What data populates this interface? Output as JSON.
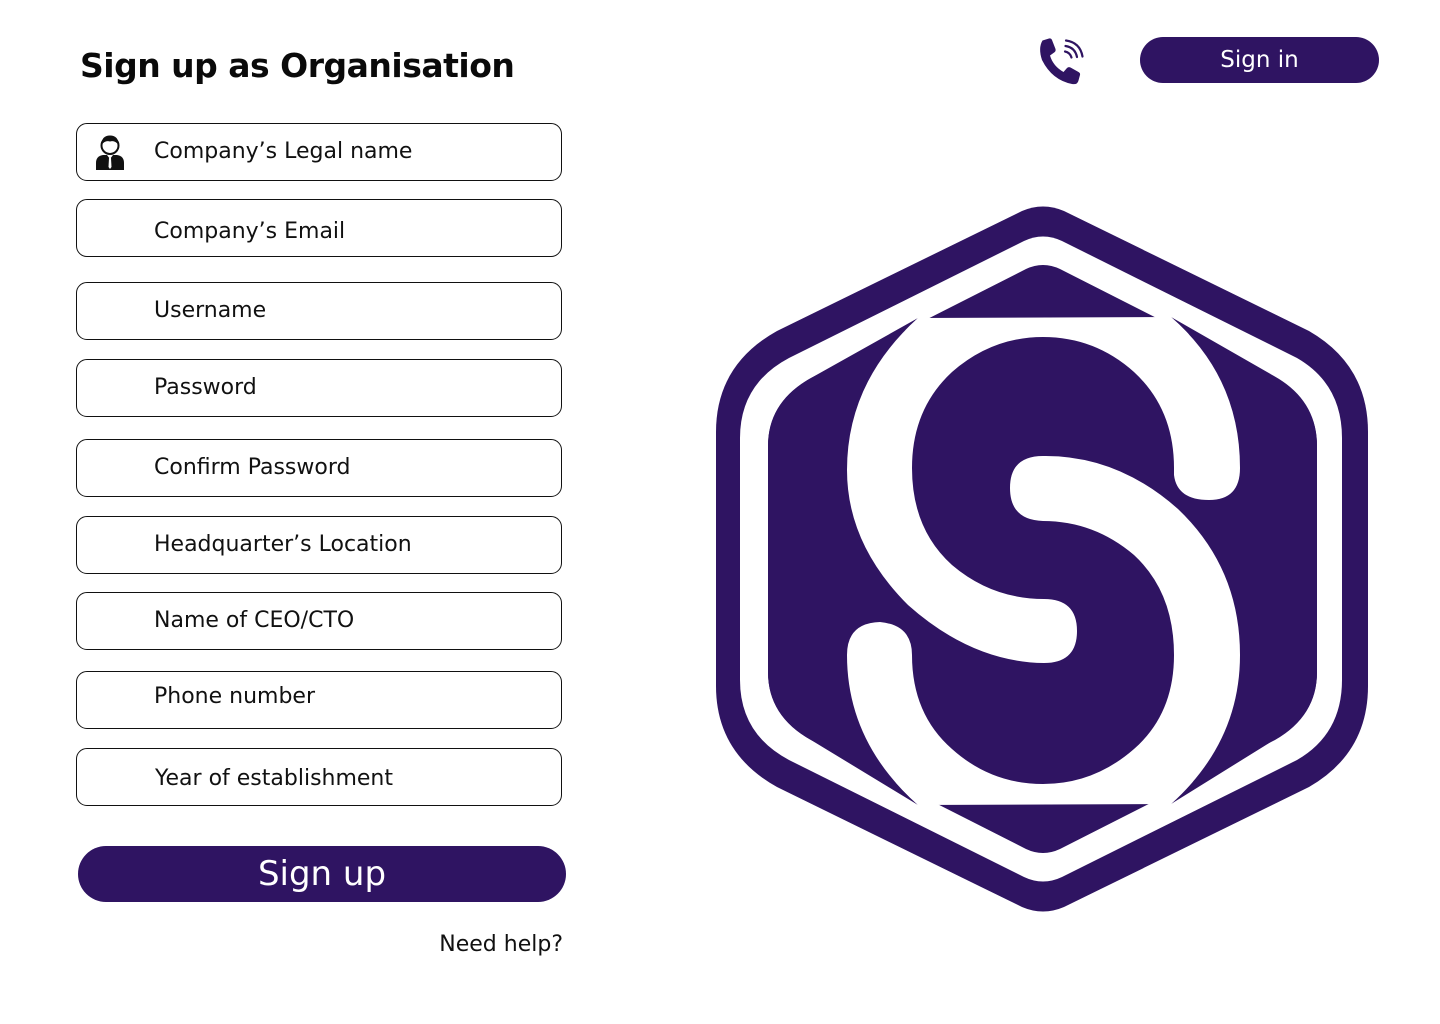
{
  "header": {
    "title": "Sign up as Organisation",
    "signin_label": "Sign in",
    "phone_icon": "phone-icon"
  },
  "form": {
    "fields": [
      {
        "name": "company-legal-name",
        "placeholder": "Company’s Legal name",
        "value": "",
        "icon": "user-icon"
      },
      {
        "name": "company-email",
        "placeholder": "Company’s Email",
        "value": ""
      },
      {
        "name": "username",
        "placeholder": "Username",
        "value": ""
      },
      {
        "name": "password",
        "placeholder": "Password",
        "value": ""
      },
      {
        "name": "confirm-password",
        "placeholder": "Confirm Password",
        "value": ""
      },
      {
        "name": "headquarter-location",
        "placeholder": "Headquarter’s Location",
        "value": ""
      },
      {
        "name": "ceo-cto-name",
        "placeholder": "Name of CEO/CTO",
        "value": ""
      },
      {
        "name": "phone-number",
        "placeholder": "Phone number",
        "value": ""
      },
      {
        "name": "year-of-establishment",
        "placeholder": "Year of establishment",
        "value": ""
      }
    ],
    "submit_label": "Sign up",
    "help_label": "Need help?"
  },
  "brand": {
    "logo_icon": "brand-logo",
    "accent_color": "#2f1462"
  }
}
